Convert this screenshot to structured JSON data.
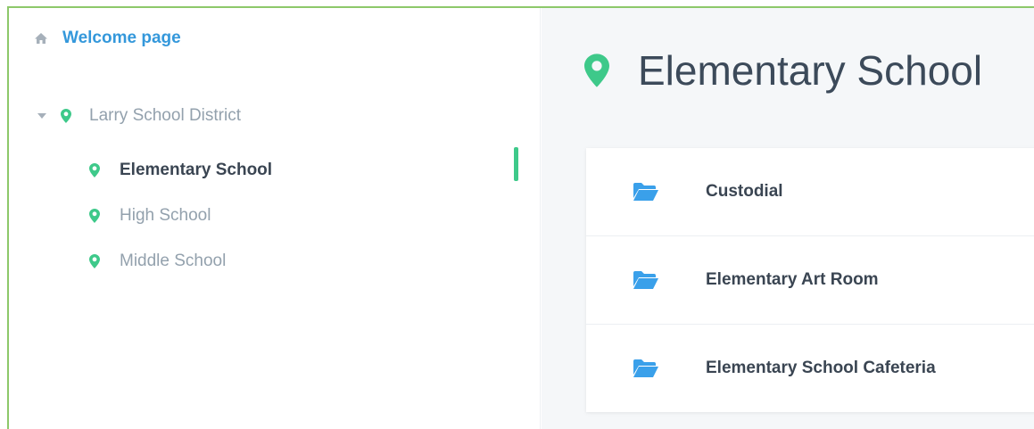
{
  "sidebar": {
    "welcome": {
      "icon": "home-icon",
      "label": "Welcome page"
    },
    "tree": {
      "root": {
        "icon": "map-pin-icon",
        "label": "Larry School District",
        "expanded": true
      },
      "children": [
        {
          "label": "Elementary School",
          "active": true
        },
        {
          "label": "High School",
          "active": false
        },
        {
          "label": "Middle School",
          "active": false
        }
      ]
    }
  },
  "main": {
    "title": "Elementary School",
    "folders": [
      {
        "icon": "folder-open-icon",
        "label": "Custodial"
      },
      {
        "icon": "folder-open-icon",
        "label": "Elementary Art Room"
      },
      {
        "icon": "folder-open-icon",
        "label": "Elementary School Cafeteria"
      }
    ]
  },
  "colors": {
    "accent_green": "#3ec98a",
    "link_blue": "#3498db",
    "folder_blue": "#3aa0ea",
    "text_dark": "#3a4552",
    "text_muted": "#93a1ad"
  }
}
